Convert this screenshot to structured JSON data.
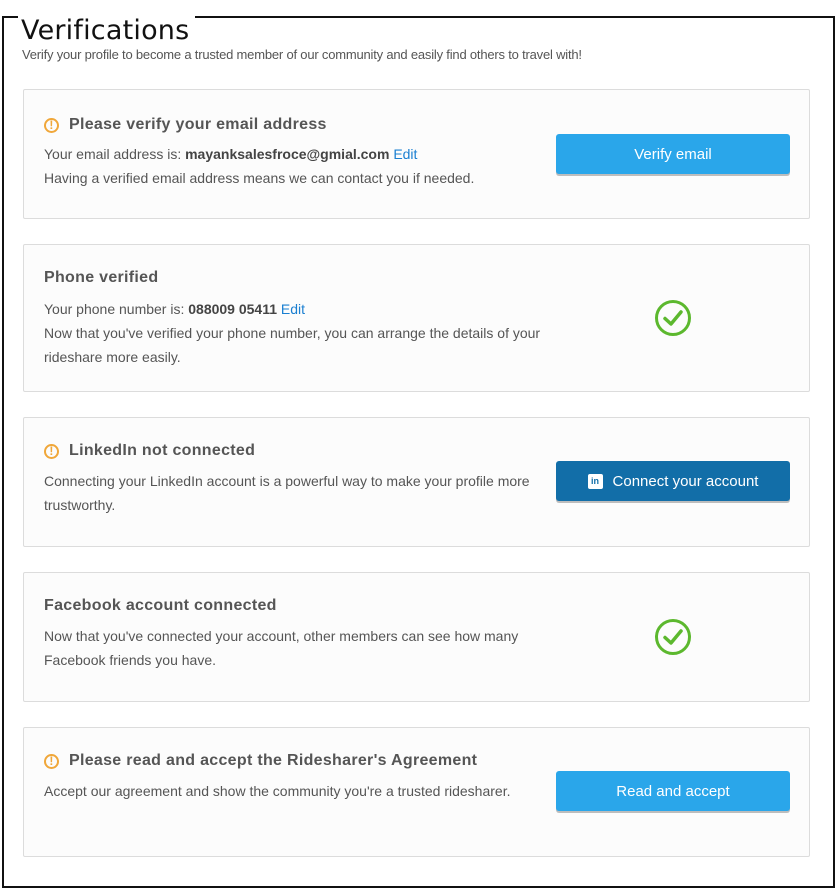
{
  "page": {
    "title": "Verifications",
    "intro": "Verify your profile to become a trusted member of our community and easily find others to travel with!"
  },
  "email_card": {
    "title": "Please verify your email address",
    "line1_prefix": "Your email address is: ",
    "email": "mayanksalesfroce@gmial.com",
    "edit_label": "Edit",
    "line2": "Having a verified email address means we can contact you if needed.",
    "button_label": "Verify email"
  },
  "phone_card": {
    "title": "Phone verified",
    "line1_prefix": "Your phone number is: ",
    "phone": "088009 05411",
    "edit_label": "Edit",
    "description": "Now that you've verified your phone number, you can arrange the details of your rideshare more easily."
  },
  "linkedin_card": {
    "title": "LinkedIn not connected",
    "description": "Connecting your LinkedIn account is a powerful way to make your profile more trustworthy.",
    "button_icon_text": "in",
    "button_label": "Connect your account"
  },
  "facebook_card": {
    "title": "Facebook account connected",
    "description": "Now that you've connected your account, other members can see how many Facebook friends you have."
  },
  "agreement_card": {
    "title": "Please read and accept the Ridesharer's Agreement",
    "description": "Accept our agreement and show the community you're a trusted ridesharer.",
    "button_label": "Read and accept"
  },
  "icons": {
    "warning": "exclamation-circle-icon",
    "verified": "check-circle-icon",
    "linkedin": "linkedin-icon"
  },
  "colors": {
    "primary_button": "#2aa6ea",
    "linkedin_button": "#126ea8",
    "warning": "#f0a73a",
    "success": "#5cb82e",
    "link": "#1a7fd1"
  }
}
